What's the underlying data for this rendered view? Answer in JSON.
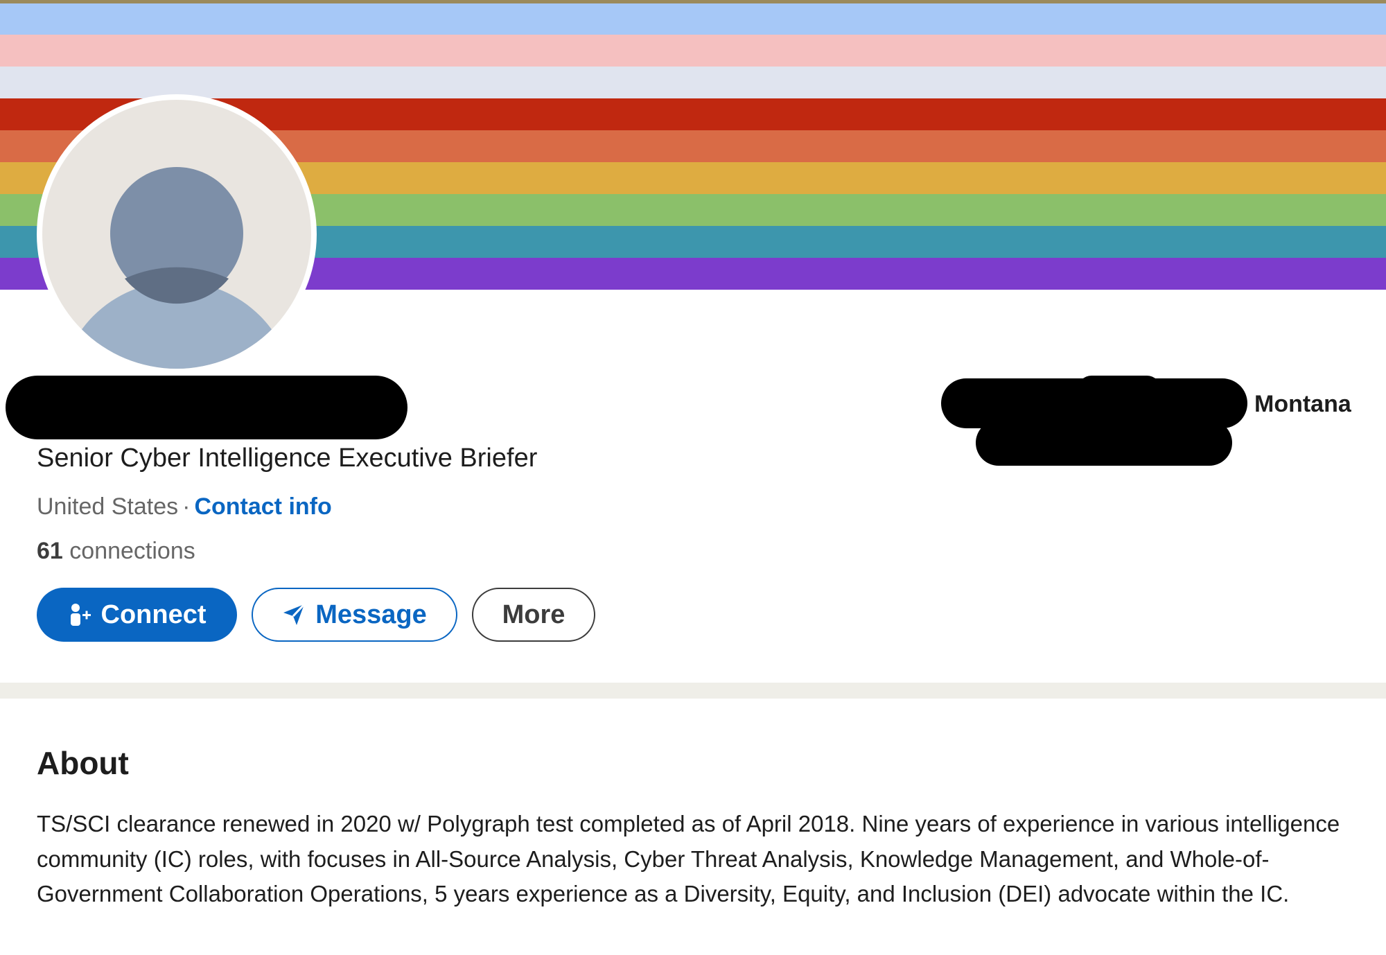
{
  "banner": {
    "stripes": [
      "#a6c8f7",
      "#f5c0c0",
      "#e0e4ef",
      "#c02810",
      "#d96b46",
      "#deac41",
      "#8bc06a",
      "#3d96ad",
      "#7c3ccc"
    ]
  },
  "profile": {
    "headline": "Senior Cyber Intelligence Executive Briefer",
    "location": "United States",
    "separator": "·",
    "contact_info_label": "Contact info",
    "connections_count": "61",
    "connections_label": "connections",
    "right_location": "Montana"
  },
  "actions": {
    "connect_label": "Connect",
    "message_label": "Message",
    "more_label": "More"
  },
  "about": {
    "title": "About",
    "text": "TS/SCI clearance renewed in 2020 w/ Polygraph test completed as of April 2018. Nine years of experience in various intelligence community (IC) roles, with focuses in All-Source Analysis, Cyber Threat Analysis, Knowledge Management, and Whole-of-Government Collaboration Operations, 5 years experience as a Diversity, Equity, and Inclusion (DEI) advocate within the IC."
  },
  "colors": {
    "accent_blue": "#0a66c2",
    "muted_text": "#666666"
  },
  "icons": {
    "connect": "person-add-icon",
    "message": "send-arrow-icon",
    "avatar": "default-person-avatar"
  }
}
